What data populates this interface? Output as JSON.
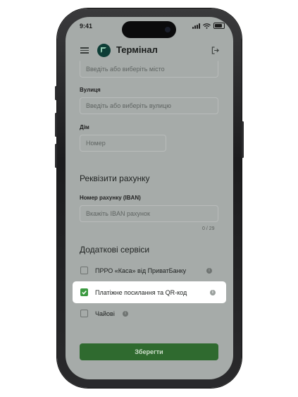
{
  "status": {
    "time": "9:41"
  },
  "header": {
    "app_title": "Термінал"
  },
  "form": {
    "city_placeholder": "Введіть або виберіть місто",
    "street_label": "Вулиця",
    "street_placeholder": "Введіть або виберіть вулицю",
    "house_label": "Дім",
    "house_placeholder": "Номер"
  },
  "bank": {
    "section_title": "Реквізити рахунку",
    "iban_label": "Номер рахунку (IBAN)",
    "iban_placeholder": "Вкажіть IBAN рахунок",
    "iban_counter": "0 / 29"
  },
  "services": {
    "section_title": "Додаткові сервіси",
    "items": [
      {
        "label": "ПРРО «Каса» від ПриватБанку",
        "checked": false
      },
      {
        "label": "Платіжне посилання та QR-код",
        "checked": true
      },
      {
        "label": "Чайові",
        "checked": false
      }
    ]
  },
  "actions": {
    "save_label": "Зберегти"
  },
  "colors": {
    "primary": "#2f6a2f",
    "check_active": "#3c9a41",
    "logo_bg": "#0d3d36"
  }
}
